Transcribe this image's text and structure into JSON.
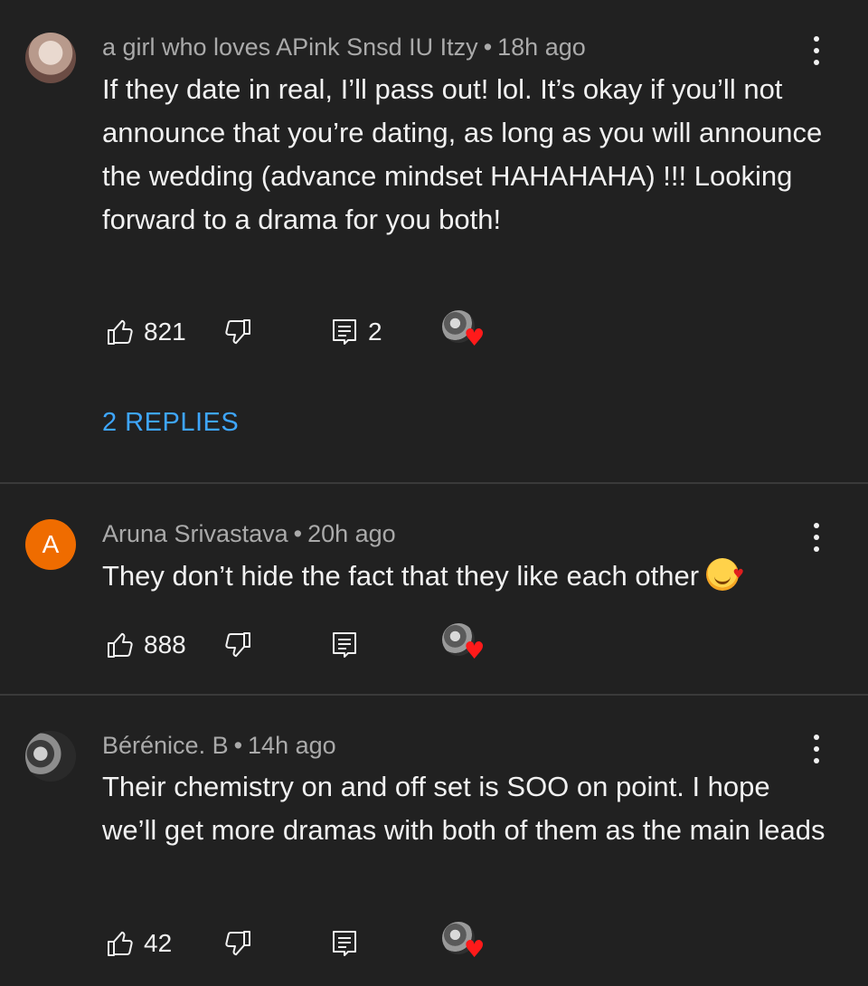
{
  "comments": [
    {
      "author": "a girl who loves APink Snsd IU Itzy",
      "time": "18h ago",
      "text": "If they date in real, I’ll pass out! lol. It’s okay if you’ll not announce that you’re dating, as long as you will announce the wedding (advance mindset HAHAHAHA) !!! Looking forward to a drama for you both!",
      "likes": "821",
      "reply_count": "2",
      "replies_label": "2 REPLIES",
      "creator_heart": true
    },
    {
      "author": "Aruna Srivastava",
      "avatar_letter": "A",
      "time": "20h ago",
      "text": "They don’t hide the fact that they like each other",
      "emoji": "smiling-face-with-hearts",
      "likes": "888",
      "creator_heart": true
    },
    {
      "author": "Bérénice. B",
      "time": "14h ago",
      "text": "Their chemistry on and off set is SOO on point. I hope we’ll get more dramas with both of them as the main leads",
      "likes": "42",
      "creator_heart": true
    }
  ],
  "dot_separator": "•",
  "icons": [
    "like-icon",
    "dislike-icon",
    "reply-icon",
    "more-options-icon",
    "creator-heart-icon"
  ],
  "colors": {
    "background": "#212121",
    "text": "#f1f1f1",
    "meta": "#aaaaaa",
    "link": "#3ea6ff",
    "avatar_orange": "#ef6c00",
    "heart": "#ff1a1a"
  }
}
